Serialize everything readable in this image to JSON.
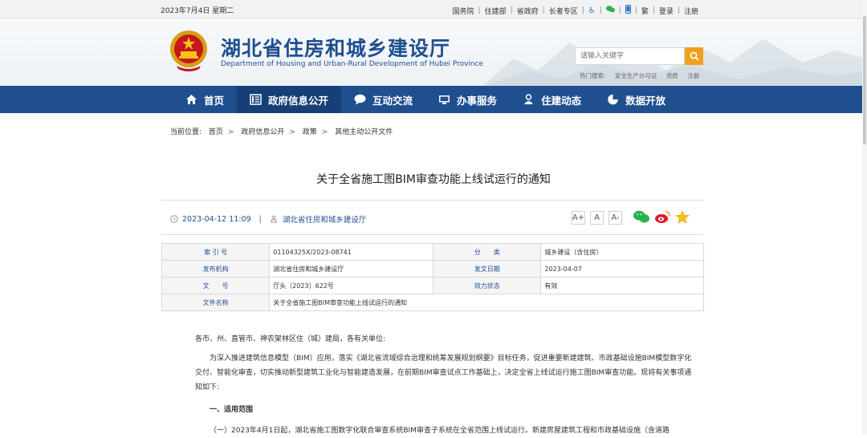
{
  "topbar": {
    "date": "2023年7月4日 星期二",
    "links": [
      "国务院",
      "住建部",
      "省政府",
      "长者专区"
    ],
    "lang": "繁",
    "login": "登录",
    "register": "注册"
  },
  "header": {
    "title_cn": "湖北省住房和城乡建设厅",
    "title_en": "Department of Housing and Urban-Rural Development of Hubei Province",
    "search_placeholder": "请输入关键字",
    "hot_label": "热门搜索:",
    "hot_terms": [
      "安全生产许可证",
      "资质",
      "注册"
    ]
  },
  "nav": {
    "items": [
      {
        "label": "首页",
        "icon": "home-icon"
      },
      {
        "label": "政府信息公开",
        "icon": "document-list-icon"
      },
      {
        "label": "互动交流",
        "icon": "chat-bubble-icon"
      },
      {
        "label": "办事服务",
        "icon": "monitor-icon"
      },
      {
        "label": "住建动态",
        "icon": "person-icon"
      },
      {
        "label": "数据开放",
        "icon": "pie-chart-icon"
      }
    ]
  },
  "breadcrumb": {
    "label": "当前位置:",
    "items": [
      "首页",
      "政府信息公开",
      "政策",
      "其他主动公开文件"
    ]
  },
  "article": {
    "title": "关于全省施工图BIM审查功能上线试运行的通知",
    "date": "2023-04-12 11:09",
    "source": "湖北省住房和城乡建设厅",
    "font_sizes": [
      "A+",
      "A",
      "A-"
    ]
  },
  "info_table": {
    "rows": [
      {
        "k1": "索 引 号",
        "v1": "01104325X/2023-08741",
        "k2": "分　　类",
        "v2": "城乡建设（含住房）"
      },
      {
        "k1": "发布机构",
        "v1": "湖北省住房和城乡建设厅",
        "k2": "发文日期",
        "v2": "2023-04-07"
      },
      {
        "k1": "文　　号",
        "v1": "厅头〔2023〕622号",
        "k2": "效力状态",
        "v2": "有效"
      }
    ],
    "name_label": "文件名称",
    "name_value": "关于全省施工图BIM审查功能上线试运行的通知"
  },
  "body": {
    "salutation": "各市、州、直管市、神农架林区住（城）建局，各有关单位:",
    "para1": "为深入推进建筑信息模型（BIM）应用，落实《湖北省流域综合治理和统筹发展规划纲要》目标任务，促进重要新建建筑、市政基础设施BIM模型数字化交付、智能化审查，切实推动新型建筑工业化与智能建造发展，在前期BIM审查试点工作基础上，决定全省上线试运行施工图BIM审查功能。现将有关事项通知如下:",
    "heading1": "一、适用范围",
    "para2": "（一）2023年4月1日起，湖北省施工图数字化联合审查系统BIM审查子系统在全省范围上线试运行。新建房屋建筑工程和市政基础设施（含道路"
  },
  "colors": {
    "brand_blue": "#1f4f8f",
    "accent_orange": "#f0a020"
  }
}
